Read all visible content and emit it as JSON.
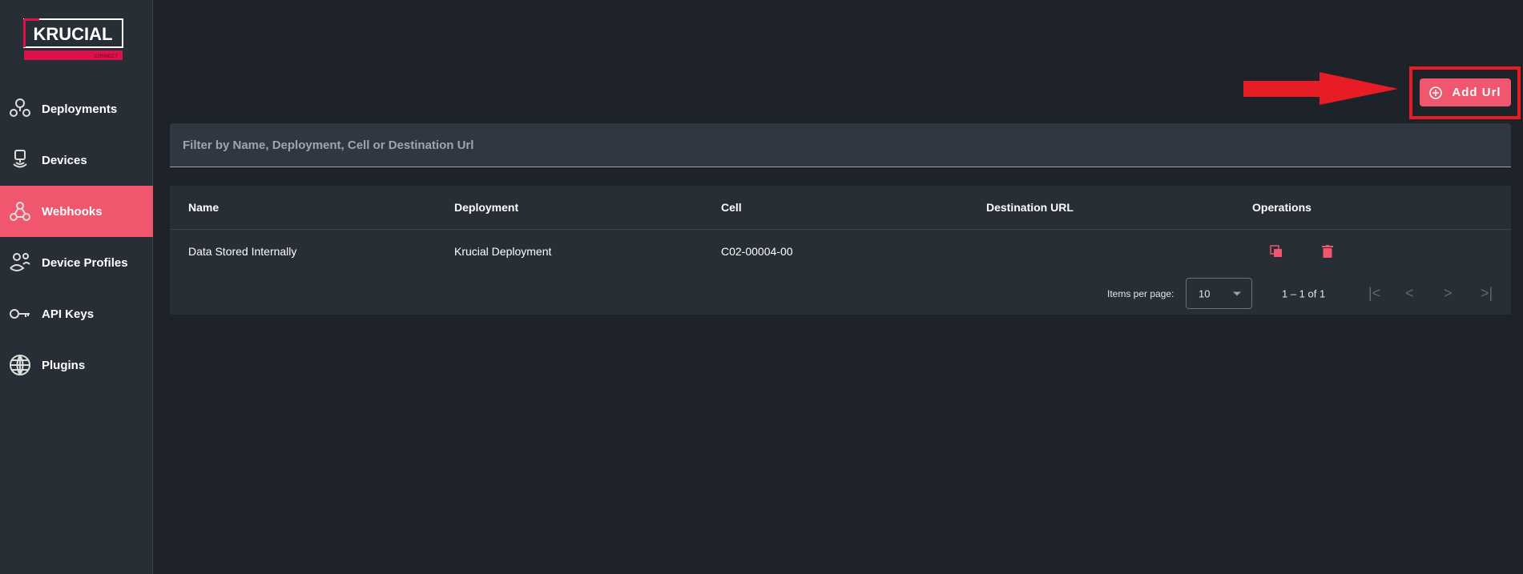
{
  "brand": {
    "name": "KRUCIAL",
    "sub": "CONNECT",
    "accent": "#f0566e"
  },
  "sidebar": {
    "items": [
      {
        "label": "Deployments",
        "icon": "map-pins-icon"
      },
      {
        "label": "Devices",
        "icon": "device-signal-icon"
      },
      {
        "label": "Webhooks",
        "icon": "webhook-icon",
        "active": true
      },
      {
        "label": "Device Profiles",
        "icon": "users-icon"
      },
      {
        "label": "API Keys",
        "icon": "key-icon"
      },
      {
        "label": "Plugins",
        "icon": "globe-icon"
      }
    ]
  },
  "toolbar": {
    "add_label": "Add Url"
  },
  "filter": {
    "placeholder": "Filter by Name, Deployment, Cell or Destination Url"
  },
  "table": {
    "columns": [
      "Name",
      "Deployment",
      "Cell",
      "Destination URL",
      "Operations"
    ],
    "rows": [
      {
        "name": "Data Stored Internally",
        "deployment": "Krucial Deployment",
        "cell": "C02-00004-00",
        "destination": ""
      }
    ]
  },
  "paginator": {
    "items_label": "Items per page:",
    "page_size": "10",
    "range": "1 – 1 of 1"
  }
}
